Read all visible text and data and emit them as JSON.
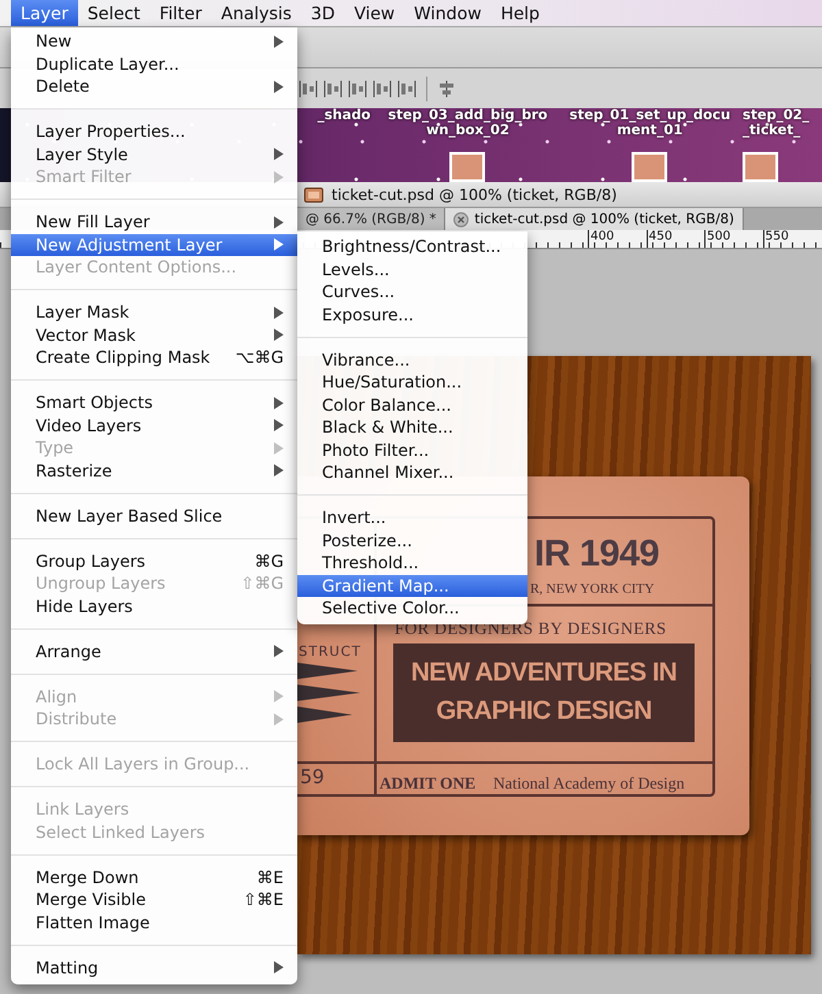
{
  "menu_bar": [
    {
      "label": "Layer",
      "selected": true
    },
    {
      "label": "Select",
      "selected": false
    },
    {
      "label": "Filter",
      "selected": false
    },
    {
      "label": "Analysis",
      "selected": false
    },
    {
      "label": "3D",
      "selected": false
    },
    {
      "label": "View",
      "selected": false
    },
    {
      "label": "Window",
      "selected": false
    },
    {
      "label": "Help",
      "selected": false
    }
  ],
  "file_browser": {
    "thumbnails": [
      {
        "lines": [
          "_shado"
        ],
        "image": false
      },
      {
        "lines": [
          "step_03_add_big_bro",
          "wn_box_02"
        ],
        "image": true
      },
      {
        "lines": [
          "step_01_set_up_docu",
          "ment_01"
        ],
        "image": true
      },
      {
        "lines": [
          "step_02_",
          "_ticket_"
        ],
        "image": true
      }
    ]
  },
  "document_window": {
    "title": "ticket-cut.psd @ 100% (ticket, RGB/8)"
  },
  "tabs": [
    {
      "label": "@ 66.7% (RGB/8) *",
      "selected": false
    },
    {
      "label": "ticket-cut.psd @ 100% (ticket, RGB/8)",
      "selected": true
    }
  ],
  "ruler": {
    "labels": [
      "400",
      "450",
      "500",
      "550"
    ]
  },
  "canvas": {
    "ticket": {
      "headline": "IR 1949",
      "subtitle": "R, NEW YORK CITY",
      "tagline": "FOR DESIGNERS BY DESIGNERS",
      "banner_lines": [
        "NEW ADVENTURES IN",
        "GRAPHIC DESIGN"
      ],
      "side_text": "STRUCT",
      "number": "59",
      "admit": "ADMIT ONE",
      "venue": "National Academy of Design"
    }
  },
  "layer_menu": {
    "items": [
      {
        "kind": "item",
        "label": "New",
        "submenu": true,
        "disabled": false,
        "selected": false
      },
      {
        "kind": "item",
        "label": "Duplicate Layer...",
        "submenu": false,
        "disabled": false,
        "selected": false
      },
      {
        "kind": "item",
        "label": "Delete",
        "submenu": true,
        "disabled": false,
        "selected": false
      },
      {
        "kind": "separator"
      },
      {
        "kind": "item",
        "label": "Layer Properties...",
        "submenu": false,
        "disabled": false,
        "selected": false
      },
      {
        "kind": "item",
        "label": "Layer Style",
        "submenu": true,
        "disabled": false,
        "selected": false
      },
      {
        "kind": "item",
        "label": "Smart Filter",
        "submenu": true,
        "disabled": true,
        "selected": false
      },
      {
        "kind": "separator"
      },
      {
        "kind": "item",
        "label": "New Fill Layer",
        "submenu": true,
        "disabled": false,
        "selected": false
      },
      {
        "kind": "item",
        "label": "New Adjustment Layer",
        "submenu": true,
        "disabled": false,
        "selected": true
      },
      {
        "kind": "item",
        "label": "Layer Content Options...",
        "submenu": false,
        "disabled": true,
        "selected": false
      },
      {
        "kind": "separator"
      },
      {
        "kind": "item",
        "label": "Layer Mask",
        "submenu": true,
        "disabled": false,
        "selected": false
      },
      {
        "kind": "item",
        "label": "Vector Mask",
        "submenu": true,
        "disabled": false,
        "selected": false
      },
      {
        "kind": "item",
        "label": "Create Clipping Mask",
        "shortcut": "⌥⌘G",
        "submenu": false,
        "disabled": false,
        "selected": false
      },
      {
        "kind": "separator"
      },
      {
        "kind": "item",
        "label": "Smart Objects",
        "submenu": true,
        "disabled": false,
        "selected": false
      },
      {
        "kind": "item",
        "label": "Video Layers",
        "submenu": true,
        "disabled": false,
        "selected": false
      },
      {
        "kind": "item",
        "label": "Type",
        "submenu": true,
        "disabled": true,
        "selected": false
      },
      {
        "kind": "item",
        "label": "Rasterize",
        "submenu": true,
        "disabled": false,
        "selected": false
      },
      {
        "kind": "separator"
      },
      {
        "kind": "item",
        "label": "New Layer Based Slice",
        "submenu": false,
        "disabled": false,
        "selected": false
      },
      {
        "kind": "separator"
      },
      {
        "kind": "item",
        "label": "Group Layers",
        "shortcut": "⌘G",
        "submenu": false,
        "disabled": false,
        "selected": false
      },
      {
        "kind": "item",
        "label": "Ungroup Layers",
        "shortcut": "⇧⌘G",
        "submenu": false,
        "disabled": true,
        "selected": false
      },
      {
        "kind": "item",
        "label": "Hide Layers",
        "submenu": false,
        "disabled": false,
        "selected": false
      },
      {
        "kind": "separator"
      },
      {
        "kind": "item",
        "label": "Arrange",
        "submenu": true,
        "disabled": false,
        "selected": false
      },
      {
        "kind": "separator"
      },
      {
        "kind": "item",
        "label": "Align",
        "submenu": true,
        "disabled": true,
        "selected": false
      },
      {
        "kind": "item",
        "label": "Distribute",
        "submenu": true,
        "disabled": true,
        "selected": false
      },
      {
        "kind": "separator"
      },
      {
        "kind": "item",
        "label": "Lock All Layers in Group...",
        "submenu": false,
        "disabled": true,
        "selected": false
      },
      {
        "kind": "separator"
      },
      {
        "kind": "item",
        "label": "Link Layers",
        "submenu": false,
        "disabled": true,
        "selected": false
      },
      {
        "kind": "item",
        "label": "Select Linked Layers",
        "submenu": false,
        "disabled": true,
        "selected": false
      },
      {
        "kind": "separator"
      },
      {
        "kind": "item",
        "label": "Merge Down",
        "shortcut": "⌘E",
        "submenu": false,
        "disabled": false,
        "selected": false
      },
      {
        "kind": "item",
        "label": "Merge Visible",
        "shortcut": "⇧⌘E",
        "submenu": false,
        "disabled": false,
        "selected": false
      },
      {
        "kind": "item",
        "label": "Flatten Image",
        "submenu": false,
        "disabled": false,
        "selected": false
      },
      {
        "kind": "separator"
      },
      {
        "kind": "item",
        "label": "Matting",
        "submenu": true,
        "disabled": false,
        "selected": false
      }
    ]
  },
  "adjustment_submenu": {
    "items": [
      {
        "kind": "item",
        "label": "Brightness/Contrast...",
        "selected": false
      },
      {
        "kind": "item",
        "label": "Levels...",
        "selected": false
      },
      {
        "kind": "item",
        "label": "Curves...",
        "selected": false
      },
      {
        "kind": "item",
        "label": "Exposure...",
        "selected": false
      },
      {
        "kind": "separator"
      },
      {
        "kind": "item",
        "label": "Vibrance...",
        "selected": false
      },
      {
        "kind": "item",
        "label": "Hue/Saturation...",
        "selected": false
      },
      {
        "kind": "item",
        "label": "Color Balance...",
        "selected": false
      },
      {
        "kind": "item",
        "label": "Black & White...",
        "selected": false
      },
      {
        "kind": "item",
        "label": "Photo Filter...",
        "selected": false
      },
      {
        "kind": "item",
        "label": "Channel Mixer...",
        "selected": false
      },
      {
        "kind": "separator"
      },
      {
        "kind": "item",
        "label": "Invert...",
        "selected": false
      },
      {
        "kind": "item",
        "label": "Posterize...",
        "selected": false
      },
      {
        "kind": "item",
        "label": "Threshold...",
        "selected": false
      },
      {
        "kind": "item",
        "label": "Gradient Map...",
        "selected": true
      },
      {
        "kind": "item",
        "label": "Selective Color...",
        "selected": false
      }
    ]
  }
}
